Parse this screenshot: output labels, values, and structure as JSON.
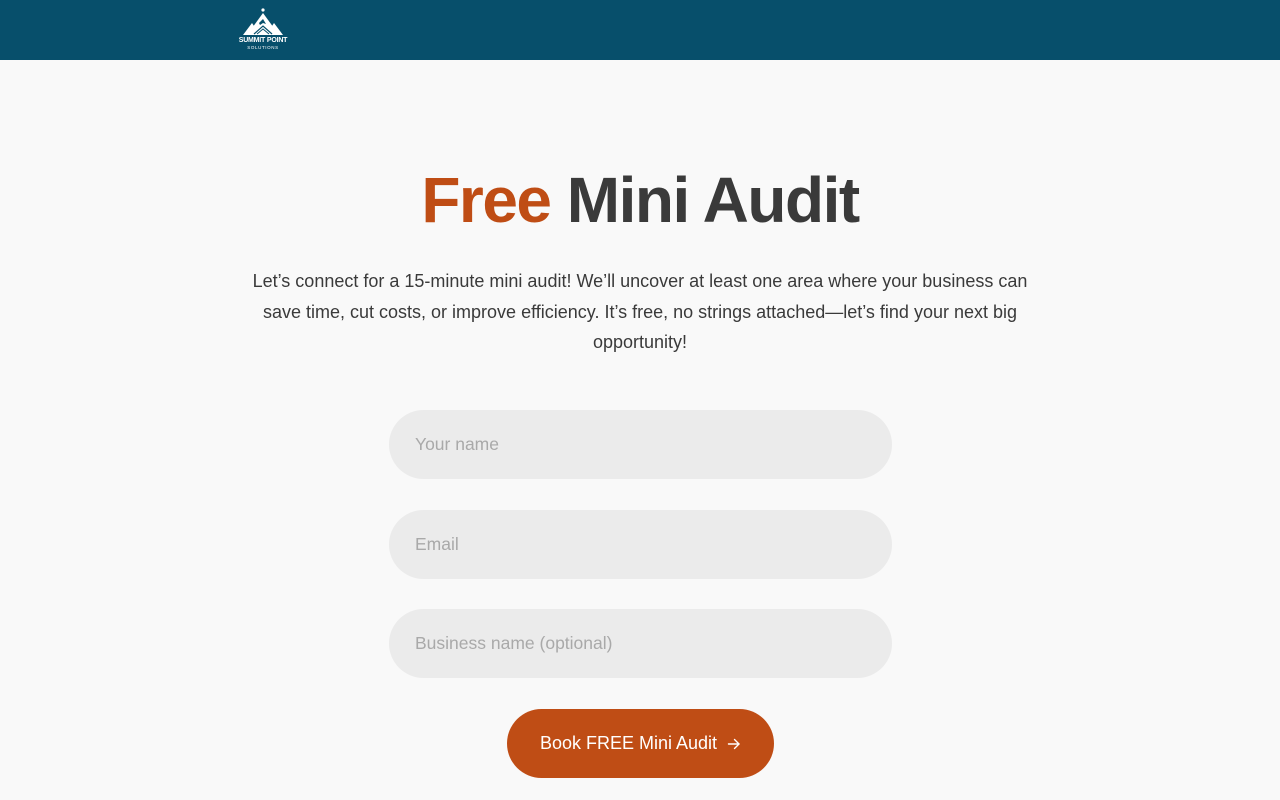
{
  "header": {
    "brand": {
      "name": "SUMMIT POINT",
      "tagline": "SOLUTIONS",
      "icon": "mountain-logo-icon"
    },
    "background_color": "#074f6b"
  },
  "hero": {
    "title_accent": "Free",
    "title_rest": "Mini Audit",
    "accent_color": "#bf4d15",
    "intro": "Let’s connect for a 15-minute mini audit! We’ll uncover at least one area where your business can save time, cut costs, or improve efficiency. It’s free, no strings attached—let’s find your next big opportunity!"
  },
  "form": {
    "name_placeholder": "Your name",
    "name_value": "",
    "email_placeholder": "Email",
    "email_value": "",
    "business_placeholder": "Business name (optional)",
    "business_value": "",
    "submit_label": "Book FREE Mini Audit",
    "submit_icon": "arrow-right-icon",
    "submit_color": "#bf4d15"
  }
}
